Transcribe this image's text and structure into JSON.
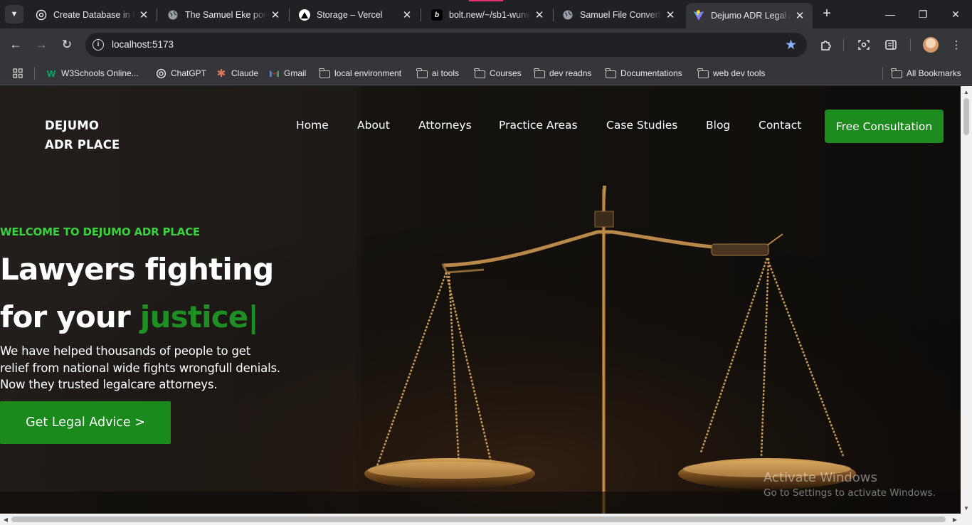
{
  "browser": {
    "tabs": [
      {
        "title": "Create Database in Po",
        "favicon": "globe-icon",
        "active": false
      },
      {
        "title": "The Samuel Eke portf",
        "favicon": "globe-icon",
        "active": false
      },
      {
        "title": "Storage – Vercel",
        "favicon": "vercel-icon",
        "active": false
      },
      {
        "title": "bolt.new/~/sb1-wunv",
        "favicon": "bolt-icon",
        "active": false
      },
      {
        "title": "Samuel File Converte",
        "favicon": "globe-icon",
        "active": false
      },
      {
        "title": "Dejumo ADR Legal Ad",
        "favicon": "vite-icon",
        "active": true
      }
    ],
    "url": "localhost:5173",
    "bookmarks": [
      {
        "label": "W3Schools Online...",
        "icon": "w3schools-icon"
      },
      {
        "label": "ChatGPT",
        "icon": "chatgpt-icon"
      },
      {
        "label": "Claude",
        "icon": "claude-icon"
      },
      {
        "label": "Gmail",
        "icon": "gmail-icon"
      },
      {
        "label": "local environment",
        "icon": "folder-icon"
      },
      {
        "label": "ai tools",
        "icon": "folder-icon"
      },
      {
        "label": "Courses",
        "icon": "folder-icon"
      },
      {
        "label": "dev readns",
        "icon": "folder-icon"
      },
      {
        "label": "Documentations",
        "icon": "folder-icon"
      },
      {
        "label": "web dev tools",
        "icon": "folder-icon"
      }
    ],
    "all_bookmarks": "All Bookmarks"
  },
  "site": {
    "logo_line1": "DEJUMO",
    "logo_line2": "ADR PLACE",
    "nav": [
      "Home",
      "About",
      "Attorneys",
      "Practice Areas",
      "Case Studies",
      "Blog",
      "Contact"
    ],
    "cta": "Free Consultation"
  },
  "hero": {
    "eyebrow": "WELCOME TO DEJUMO ADR PLACE",
    "headline_line1": "Lawyers fighting",
    "headline_line2": "for your",
    "headline_accent": "justice|",
    "lead_lines": [
      "We have helped thousands of people to get",
      "relief from national wide fights wrongfull denials.",
      "Now they trusted legalcare attorneys."
    ],
    "button": "Get Legal Advice >"
  },
  "overlay": {
    "activate_title": "Activate Windows",
    "activate_sub": "Go to Settings to activate Windows."
  },
  "colors": {
    "brand_green": "#1c8c1e",
    "eyebrow_green": "#39d13d",
    "chrome_dark": "#202124",
    "chrome_toolbar": "#35363a"
  }
}
